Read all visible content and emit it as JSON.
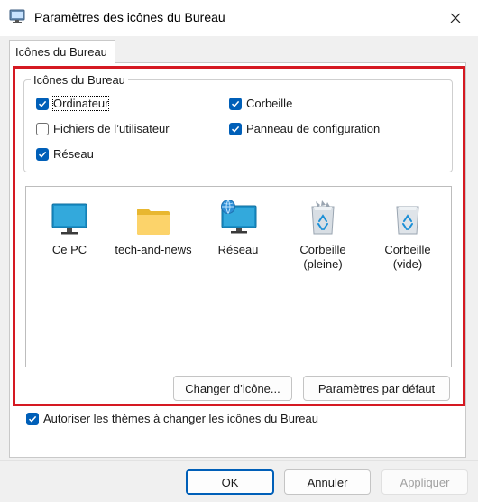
{
  "window": {
    "title": "Paramètres des icônes du Bureau"
  },
  "tabs": [
    {
      "label": "Icônes du Bureau"
    }
  ],
  "group": {
    "label": "Icônes du Bureau",
    "checkboxes": [
      {
        "label": "Ordinateur",
        "checked": true
      },
      {
        "label": "Corbeille",
        "checked": true
      },
      {
        "label": "Fichiers de l’utilisateur",
        "checked": false
      },
      {
        "label": "Panneau de configuration",
        "checked": true
      },
      {
        "label": "Réseau",
        "checked": true
      }
    ]
  },
  "icons": [
    {
      "label": "Ce PC",
      "icon": "monitor-icon"
    },
    {
      "label": "tech-and-news",
      "icon": "folder-icon"
    },
    {
      "label": "Réseau",
      "icon": "network-monitor-icon"
    },
    {
      "label": "Corbeille\n(pleine)",
      "icon": "recycle-bin-full-icon"
    },
    {
      "label": "Corbeille\n(vide)",
      "icon": "recycle-bin-empty-icon"
    }
  ],
  "buttons": {
    "change_icon": "Changer d’icône...",
    "defaults": "Paramètres par défaut",
    "ok": "OK",
    "cancel": "Annuler",
    "apply": "Appliquer"
  },
  "themes_checkbox": {
    "label": "Autoriser les thèmes à changer les icônes du Bureau",
    "checked": true
  },
  "colors": {
    "accent": "#005fb8",
    "highlight_frame": "#d51922"
  }
}
